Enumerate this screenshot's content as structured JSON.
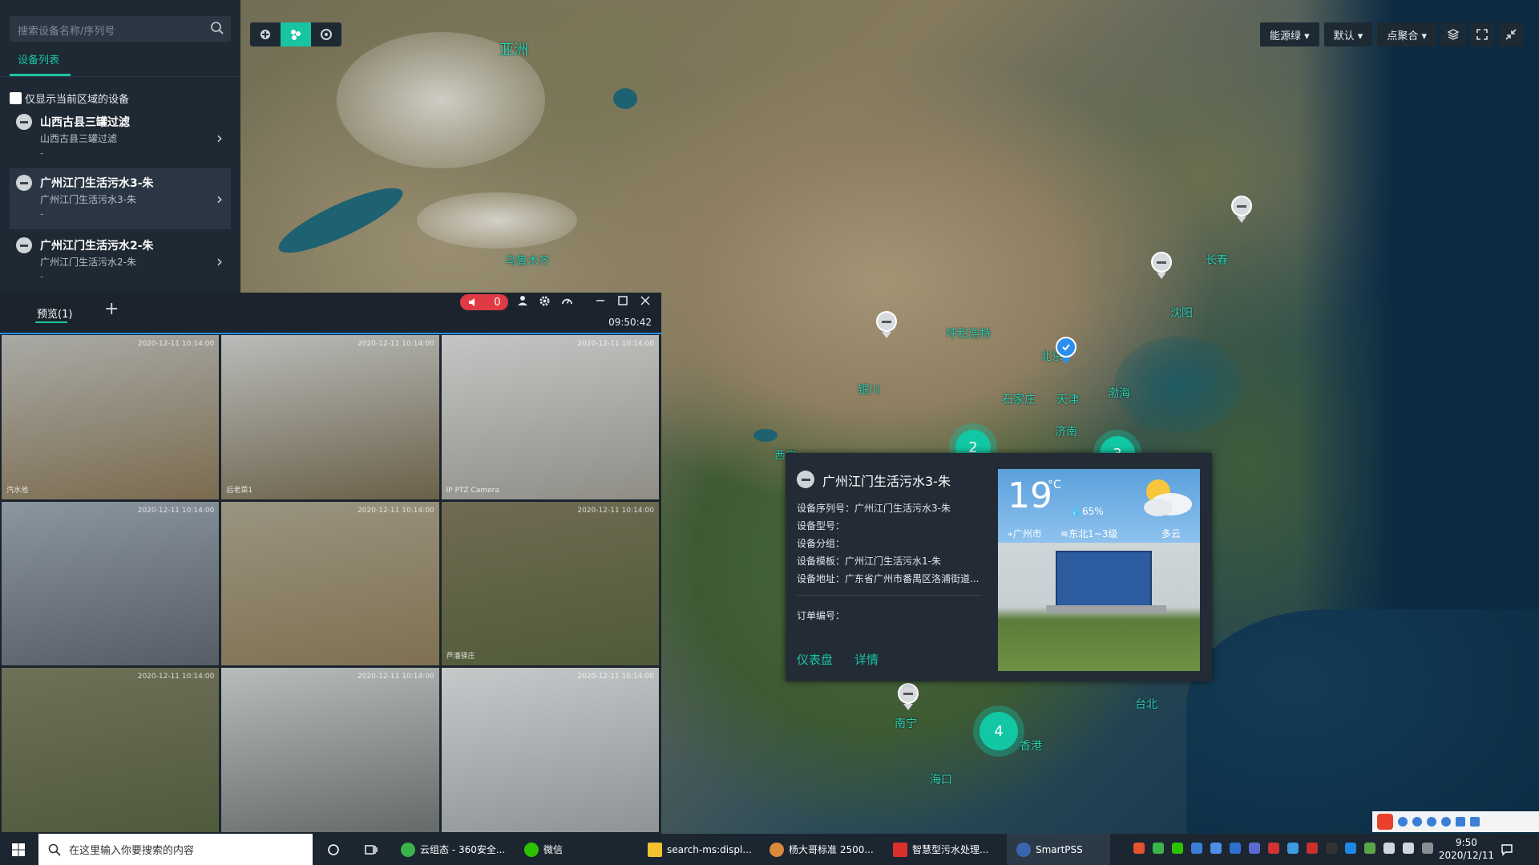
{
  "map": {
    "labels": [
      "亚洲",
      "乌鲁木齐",
      "呼和浩特",
      "北京",
      "天津",
      "石家庄",
      "济南",
      "银川",
      "渤海",
      "长春",
      "沈阳",
      "南宁",
      "海口",
      "香港",
      "台北",
      "西宁",
      "郑州",
      "南昌"
    ],
    "clusters": [
      "2",
      "3",
      "4"
    ]
  },
  "toolbar_left": {
    "icons": [
      "target-icon",
      "cluster-icon",
      "layer-toggle-icon"
    ]
  },
  "toolbar_right": {
    "dropdowns": [
      "能源绿 ▾",
      "默认 ▾",
      "点聚合 ▾"
    ],
    "icons": [
      "layers-icon",
      "fullscreen-icon",
      "shrink-icon"
    ]
  },
  "sidebar": {
    "search_placeholder": "搜索设备名称/序列号",
    "tab": "设备列表",
    "only_current_region": "仅显示当前区域的设备",
    "devices": [
      {
        "name": "山西古县三罐过滤",
        "sub": "山西古县三罐过滤",
        "extra": "-"
      },
      {
        "name": "广州江门生活污水3-朱",
        "sub": "广州江门生活污水3-朱",
        "extra": "-"
      },
      {
        "name": "广州江门生活污水2-朱",
        "sub": "广州江门生活污水2-朱",
        "extra": "-"
      }
    ]
  },
  "preview": {
    "tab": "预览(1)",
    "alarm_count": "0",
    "time": "09:50:42",
    "cams": [
      {
        "ts": "2020-12-11 10:14:00",
        "label": "汽水池",
        "colors": [
          "#a9aaa6",
          "#7b6b4f"
        ]
      },
      {
        "ts": "2020-12-11 10:14:00",
        "label": "后老菜1",
        "colors": [
          "#b9bcba",
          "#6b6049"
        ]
      },
      {
        "ts": "2020-12-11 10:14:00",
        "label": "IP PTZ Camera",
        "colors": [
          "#c4c5c4",
          "#8f8d86"
        ]
      },
      {
        "ts": "2020-12-11 10:14:00",
        "label": "",
        "colors": [
          "#8c96a0",
          "#555d66"
        ]
      },
      {
        "ts": "2020-12-11 10:14:00",
        "label": "",
        "colors": [
          "#9a9481",
          "#7f7051"
        ]
      },
      {
        "ts": "2020-12-11 10:14:00",
        "label": "芦潘驿庄",
        "colors": [
          "#706a53",
          "#4f5b38"
        ]
      },
      {
        "ts": "2020-12-11 10:14:00",
        "label": "",
        "colors": [
          "#6f7058",
          "#4f5a3d"
        ]
      },
      {
        "ts": "2020-12-11 10:14:00",
        "label": "",
        "colors": [
          "#b8bcbb",
          "#646a6a"
        ]
      },
      {
        "ts": "2020-12-11 10:14:00",
        "label": "",
        "colors": [
          "#c6c9ca",
          "#8e9394"
        ]
      }
    ]
  },
  "popup": {
    "title": "广州江门生活污水3-朱",
    "serial": "设备序列号：广州江门生活污水3-朱",
    "model": "设备型号：",
    "group": "设备分组：",
    "template": "设备模板：广州江门生活污水1-朱",
    "address": "设备地址：广东省广州市番禺区洛浦街道...",
    "order": "订单编号：",
    "link_dashboard": "仪表盘",
    "link_detail": "详情",
    "weather": {
      "temp": "19",
      "unit": "°C",
      "humidity": "65%",
      "city": "广州市",
      "wind": "东北1~3级",
      "condition": "多云"
    }
  },
  "taskbar": {
    "search": "在这里输入你要搜索的内容",
    "apps": [
      {
        "label": "云组态 - 360安全...",
        "color": "#3bb34a"
      },
      {
        "label": "微信",
        "color": "#2dc100"
      },
      {
        "label": "search-ms:displ...",
        "color": "#f2c12e"
      },
      {
        "label": "杨大哥标准 2500...",
        "color": "#d98a3a"
      },
      {
        "label": "智慧型污水处理...",
        "color": "#d9302c"
      },
      {
        "label": "SmartPSS",
        "color": "#3a66b0"
      }
    ],
    "time": "9:50",
    "date": "2020/12/11"
  }
}
